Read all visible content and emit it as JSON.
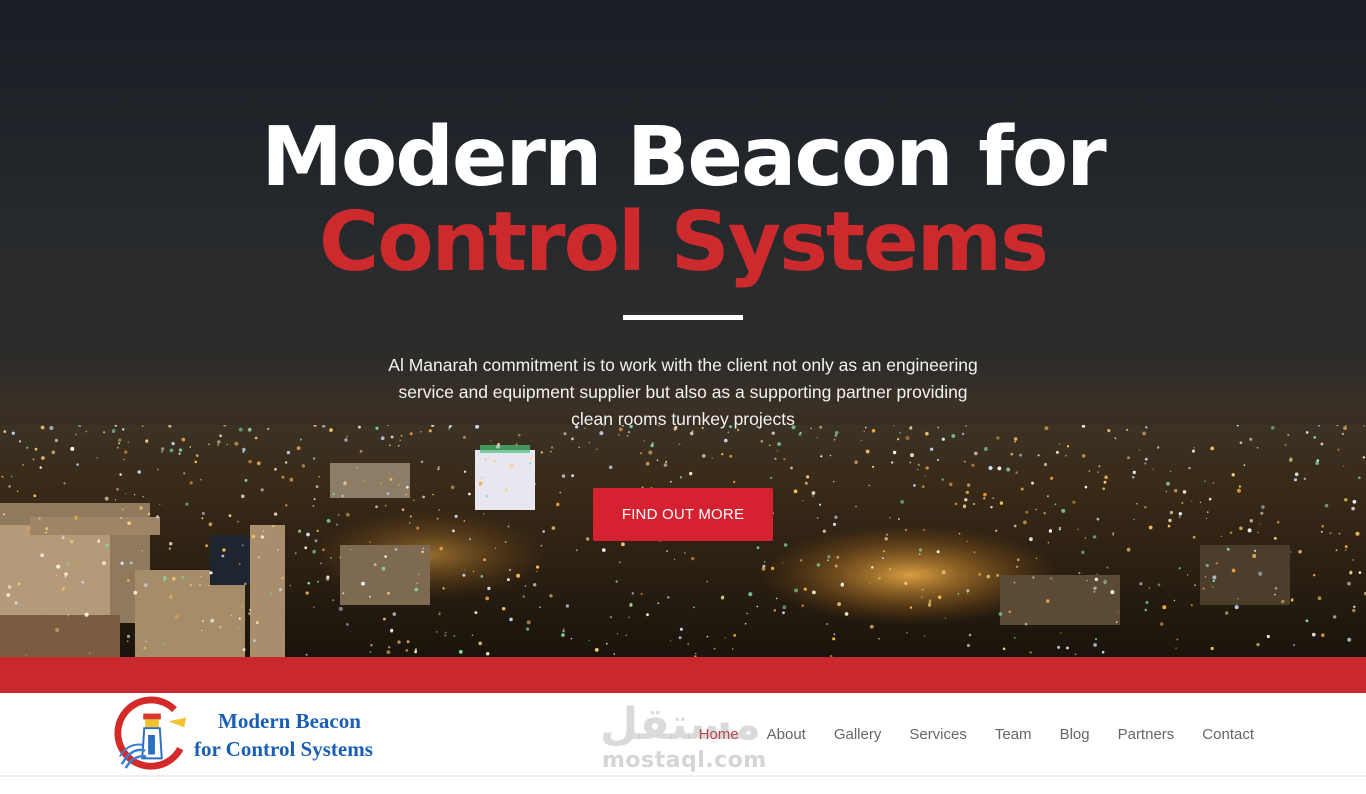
{
  "hero": {
    "title_line1": "Modern Beacon for",
    "title_line2": "Control Systems",
    "description": "Al Manarah commitment is to work with the client not only as an engineering service and equipment supplier but also as a supporting partner providing clean rooms turnkey projects",
    "cta_label": "FIND OUT MORE",
    "background_image": "night-city-skyline"
  },
  "brand": {
    "logo_icon": "lighthouse-logo-icon",
    "name_line1": "Modern Beacon",
    "name_line2": "for Control Systems"
  },
  "nav": {
    "items": [
      {
        "label": "Home",
        "active": true
      },
      {
        "label": "About",
        "active": false
      },
      {
        "label": "Gallery",
        "active": false
      },
      {
        "label": "Services",
        "active": false
      },
      {
        "label": "Team",
        "active": false
      },
      {
        "label": "Blog",
        "active": false
      },
      {
        "label": "Partners",
        "active": false
      },
      {
        "label": "Contact",
        "active": false
      }
    ]
  },
  "watermark": {
    "arabic": "مستقل",
    "latin": "mostaql.com"
  },
  "colors": {
    "accent_red": "#c9282d",
    "button_red": "#d62230",
    "logo_blue": "#1a5fb4",
    "nav_text": "#666666"
  }
}
